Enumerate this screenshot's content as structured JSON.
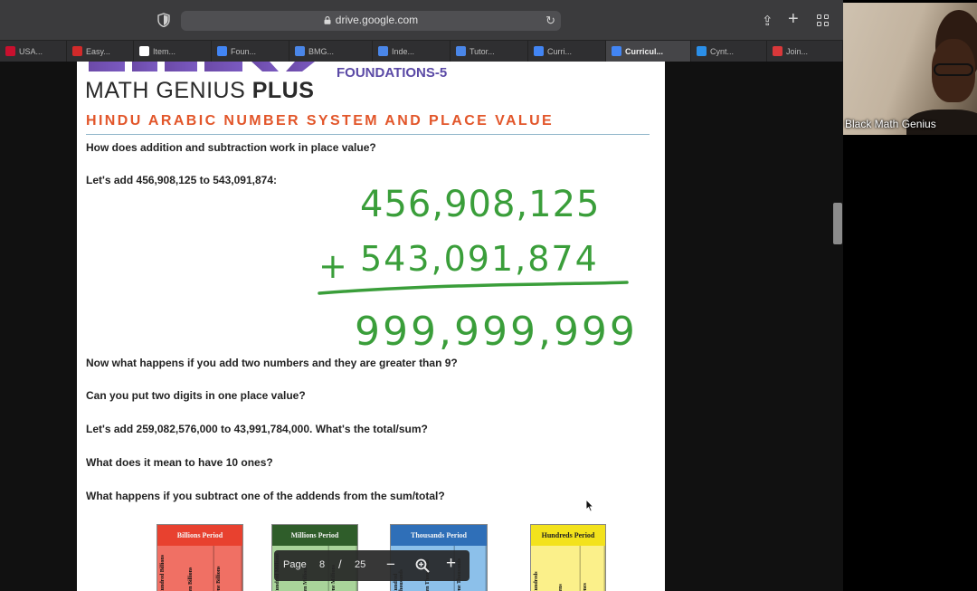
{
  "browser": {
    "url": "drive.google.com",
    "reload_glyph": "↻",
    "share_glyph": "⇪",
    "newtab_glyph": "+",
    "tabs": [
      {
        "label": "USA...",
        "icon_color": "#c8102e",
        "active": false
      },
      {
        "label": "Easy...",
        "icon_color": "#d22a2a",
        "active": false
      },
      {
        "label": "Item...",
        "icon_color": "#ffffff",
        "active": false
      },
      {
        "label": "Foun...",
        "icon_color": "#4285f4",
        "active": false
      },
      {
        "label": "BMG...",
        "icon_color": "#4a86e8",
        "active": false
      },
      {
        "label": "Inde...",
        "icon_color": "#4a86e8",
        "active": false
      },
      {
        "label": "Tutor...",
        "icon_color": "#4a86e8",
        "active": false
      },
      {
        "label": "Curri...",
        "icon_color": "#4285f4",
        "active": false
      },
      {
        "label": "Curricul...",
        "icon_color": "#4285f4",
        "active": true
      },
      {
        "label": "Cynt...",
        "icon_color": "#2b8fe8",
        "active": false
      },
      {
        "label": "Join...",
        "icon_color": "#d9383a",
        "active": false
      }
    ]
  },
  "document": {
    "logo_text_1": "MATH GENIUS ",
    "logo_text_2": "PLUS",
    "subtitle": "FOUNDATIONS-5",
    "title": "HINDU ARABIC NUMBER SYSTEM AND PLACE VALUE",
    "questions": [
      "How does addition and subtraction work in place value?",
      "Let's add 456,908,125 to 543,091,874:",
      "Now what happens if you add two numbers and they are greater than 9?",
      "Can you put two digits in one place value?",
      "Let's add 259,082,576,000 to 43,991,784,000. What's the total/sum?",
      "What does it mean to have 10 ones?",
      "What happens if you subtract one of the addends from the sum/total?"
    ],
    "handwriting": {
      "addend1": "456,908,125",
      "plus": "+",
      "addend2": "543,091,874",
      "sum": "999,999,999",
      "ink_color": "#3a9e3a"
    },
    "periods": [
      {
        "title": "Billions Period",
        "color": "#e8412f",
        "body_color": "#f07064",
        "cols": [
          "Hundred Billions",
          "Ten Billions",
          "One Billions"
        ]
      },
      {
        "title": "Millions Period",
        "color": "#2f5d2a",
        "body_color": "#a9d49a",
        "cols": [
          "Hundred Millions",
          "Ten Millions",
          "One Millions"
        ]
      },
      {
        "title": "Thousands Period",
        "color": "#2f6fb8",
        "body_color": "#8cc0ea",
        "cols": [
          "Hundred Thousands",
          "Ten Thousands",
          "One Thousands"
        ]
      },
      {
        "title": "Hundreds Period",
        "color": "#f3e21c",
        "body_color": "#fbf08a",
        "cols": [
          "Hundreds",
          "Tens",
          "Ones"
        ]
      }
    ]
  },
  "page_nav": {
    "label": "Page",
    "current": "8",
    "separator": "/",
    "total": "25",
    "zoom_out": "−",
    "zoom_in": "+"
  },
  "video": {
    "participant_name": "Black Math Genius"
  }
}
